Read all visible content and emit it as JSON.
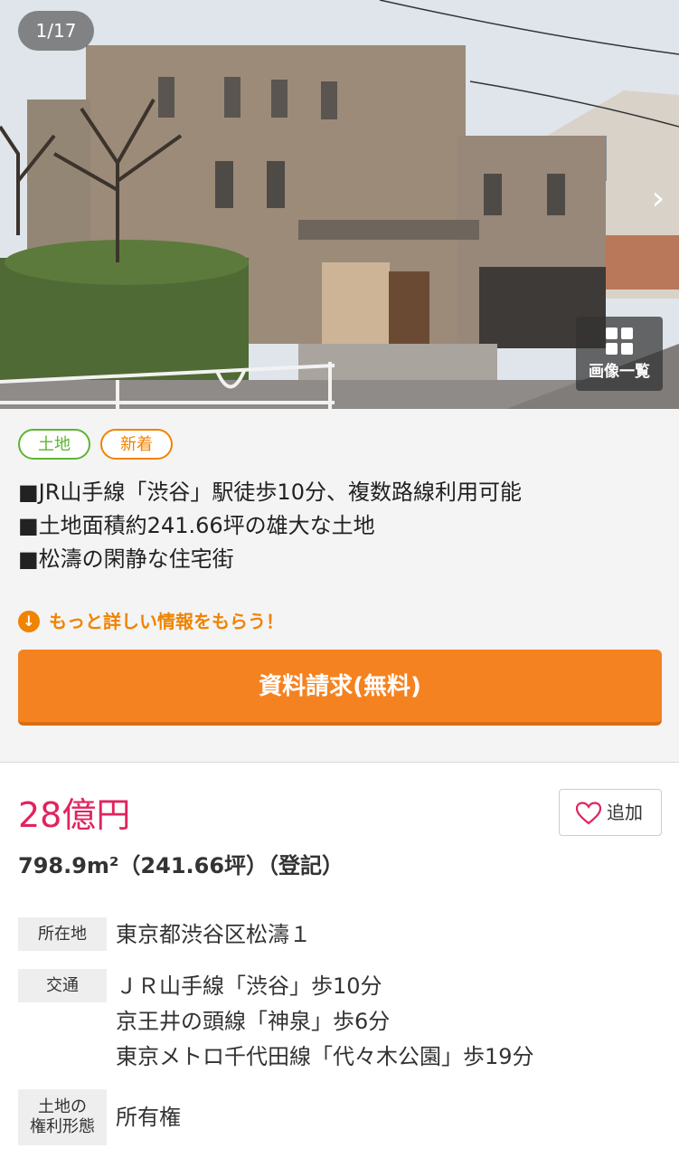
{
  "gallery": {
    "counter": "1/17",
    "next_icon": "chevron-right-icon",
    "list_icon": "grid-icon",
    "list_label": "画像一覧"
  },
  "tags": [
    "土地",
    "新着"
  ],
  "features": [
    "■JR山手線「渋谷」駅徒歩10分、複数路線利用可能",
    "■土地面積約241.66坪の雄大な土地",
    "■松濤の閑静な住宅街"
  ],
  "cta": {
    "hint": "もっと詳しい情報をもらう！",
    "hint_icon": "arrow-down-circle-icon",
    "button_label": "資料請求(無料)"
  },
  "listing": {
    "price": "28億円",
    "favorite_label": "追加",
    "favorite_icon": "heart-icon",
    "area": "798.9m²（241.66坪）（登記）"
  },
  "details": {
    "location_label": "所在地",
    "location_value": "東京都渋谷区松濤１",
    "transit_label": "交通",
    "transit_lines": [
      "ＪＲ山手線「渋谷」歩10分",
      "京王井の頭線「神泉」歩6分",
      "東京メトロ千代田線「代々木公園」歩19分"
    ],
    "rights_label_1": "土地の",
    "rights_label_2": "権利形態",
    "rights_value": "所有権"
  },
  "colors": {
    "accent": "#f58220",
    "price": "#e0245e",
    "tag_land": "#5cb531",
    "tag_new": "#f08300"
  }
}
